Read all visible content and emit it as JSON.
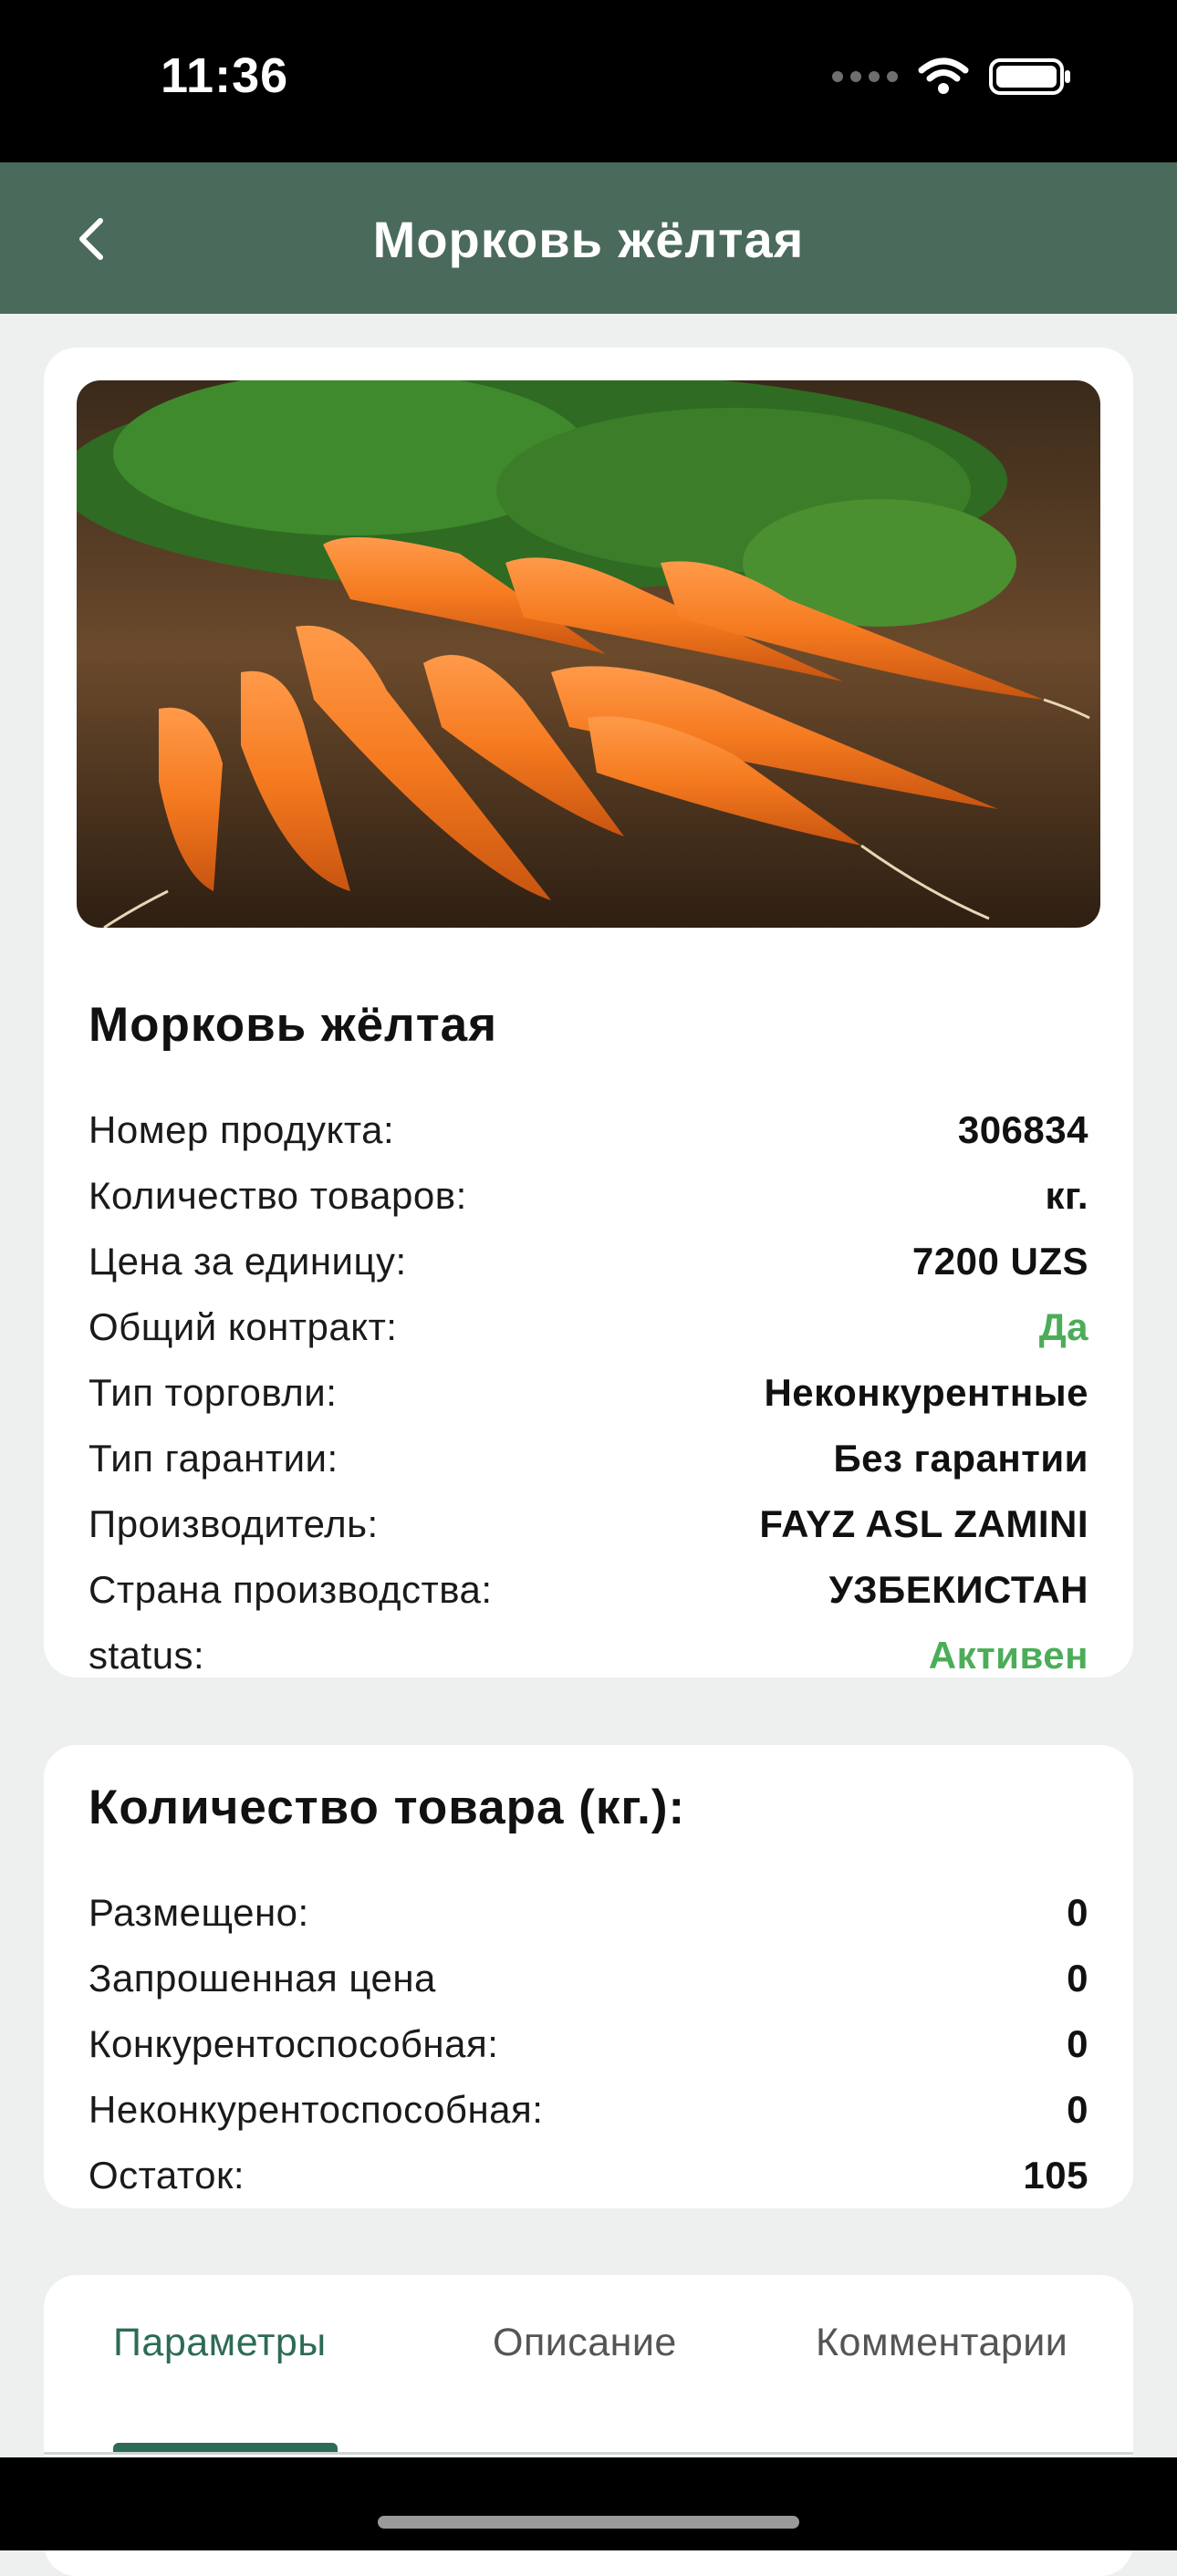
{
  "status_bar": {
    "time": "11:36"
  },
  "header": {
    "title": "Морковь жёлтая"
  },
  "product": {
    "title": "Морковь жёлтая",
    "details": [
      {
        "label": "Номер продукта:",
        "value": "306834"
      },
      {
        "label": "Количество товаров:",
        "value": "кг."
      },
      {
        "label": "Цена за единицу:",
        "value": "7200 UZS"
      },
      {
        "label": "Общий контракт:",
        "value": "Да",
        "highlight": "#4cad58"
      },
      {
        "label": "Тип торговли:",
        "value": "Неконкурентные"
      },
      {
        "label": "Тип гарантии:",
        "value": "Без гарантии"
      },
      {
        "label": "Производитель:",
        "value": "FAYZ ASL ZAMINI"
      },
      {
        "label": "Страна производства:",
        "value": "УЗБЕКИСТАН"
      },
      {
        "label": "status:",
        "value": "Активен",
        "highlight": "#4cad58"
      }
    ]
  },
  "quantity": {
    "title": "Количество товара (кг.):",
    "rows": [
      {
        "label": "Размещено:",
        "value": "0"
      },
      {
        "label": "Запрошенная цена",
        "value": "0"
      },
      {
        "label": "Конкурентоспособная:",
        "value": "0"
      },
      {
        "label": "Неконкурентоспособная:",
        "value": "0"
      },
      {
        "label": "Остаток:",
        "value": "105"
      }
    ]
  },
  "tabs": {
    "items": [
      "Параметры",
      "Описание",
      "Комментарии"
    ],
    "active": "Параметры"
  },
  "colors": {
    "header_bg": "#4a6a5c",
    "accent_green": "#4cad58",
    "tab_active": "#2d6b55"
  }
}
